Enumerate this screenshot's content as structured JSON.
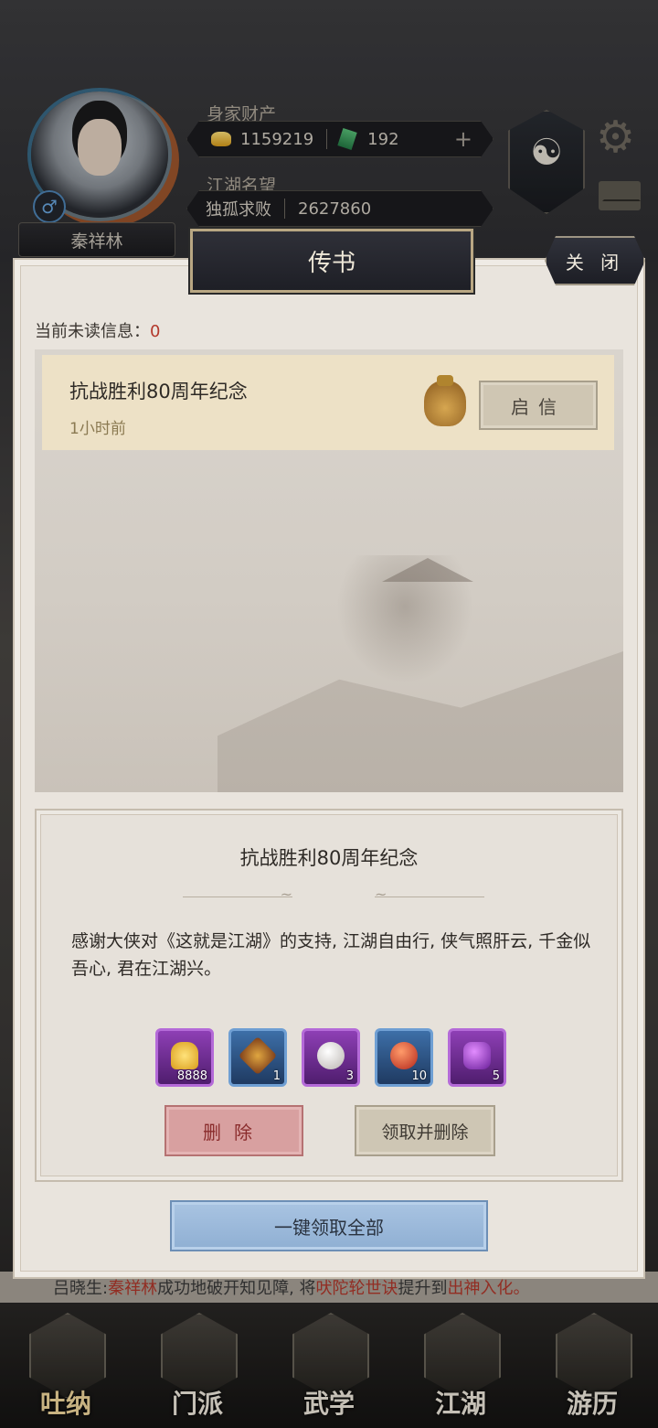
{
  "player": {
    "name": "秦祥林",
    "gender_symbol": "♂",
    "wealth_label": "身家财产",
    "gold": "1159219",
    "jade": "192",
    "fame_label": "江湖名望",
    "fame_title": "独孤求败",
    "fame_value": "2627860",
    "emblem_symbol": "☯"
  },
  "icons": {
    "gear": "⚙",
    "plus": "+"
  },
  "marquee": {
    "prefix": "吕晓生: ",
    "name": "秦祥林",
    "middle": "成功地破开知见障, 将",
    "skill": "吠陀轮世诀",
    "suffix": "提升到",
    "level": "出神入化。"
  },
  "nav": {
    "items": [
      {
        "label": "吐纳"
      },
      {
        "label": "门派"
      },
      {
        "label": "武学"
      },
      {
        "label": "江湖"
      },
      {
        "label": "游历"
      }
    ]
  },
  "panel": {
    "title": "传书",
    "close_label": "关 闭",
    "unread_label": "当前未读信息：",
    "unread_count": "0"
  },
  "mail_list": [
    {
      "title": "抗战胜利80周年纪念",
      "time": "1小时前",
      "open_label": "启信"
    }
  ],
  "detail": {
    "title": "抗战胜利80周年纪念",
    "body": "感谢大侠对《这就是江湖》的支持, 江湖自由行, 侠气照肝云, 千金似吾心, 君在江湖兴。",
    "rewards": [
      {
        "icon": "gold-ingot-icon",
        "qty": "8888",
        "rarity": "purple"
      },
      {
        "icon": "scroll-token-icon",
        "qty": "1",
        "rarity": "blue"
      },
      {
        "icon": "pearl-icon",
        "qty": "3",
        "rarity": "purple"
      },
      {
        "icon": "red-orb-icon",
        "qty": "10",
        "rarity": "blue"
      },
      {
        "icon": "purple-gem-icon",
        "qty": "5",
        "rarity": "purple"
      }
    ],
    "delete_label": "删除",
    "claim_delete_label": "领取并删除",
    "claim_all_label": "一键领取全部"
  },
  "colors": {
    "accent_red": "#b3382b",
    "purple_rarity": "#8e3fb5",
    "blue_rarity": "#3d6fa8"
  }
}
